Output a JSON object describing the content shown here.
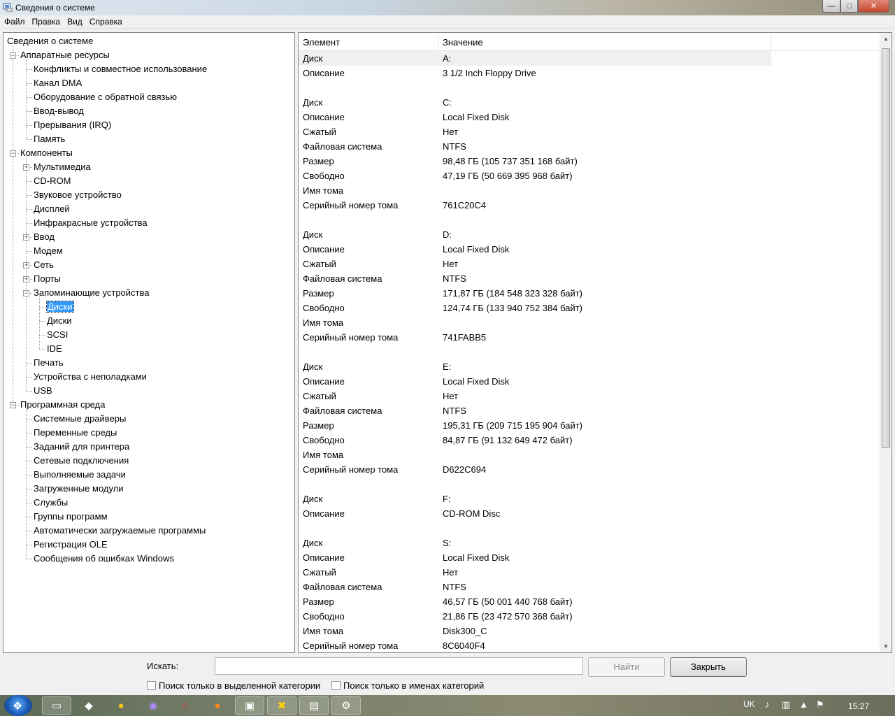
{
  "window": {
    "title": "Сведения о системе",
    "controls": {
      "minimize": "—",
      "maximize": "□",
      "close": "✕"
    }
  },
  "menu": [
    "Файл",
    "Правка",
    "Вид",
    "Справка"
  ],
  "tree": [
    {
      "label": "Сведения о системе",
      "level": 0,
      "expander": ""
    },
    {
      "label": "Аппаратные ресурсы",
      "level": 1,
      "expander": "minus"
    },
    {
      "label": "Конфликты и совместное использование",
      "level": 2,
      "expander": ""
    },
    {
      "label": "Канал DMA",
      "level": 2,
      "expander": ""
    },
    {
      "label": "Оборудование с обратной связью",
      "level": 2,
      "expander": ""
    },
    {
      "label": "Ввод-вывод",
      "level": 2,
      "expander": ""
    },
    {
      "label": "Прерывания (IRQ)",
      "level": 2,
      "expander": ""
    },
    {
      "label": "Память",
      "level": 2,
      "expander": ""
    },
    {
      "label": "Компоненты",
      "level": 1,
      "expander": "minus"
    },
    {
      "label": "Мультимедиа",
      "level": 2,
      "expander": "plus"
    },
    {
      "label": "CD-ROM",
      "level": 2,
      "expander": ""
    },
    {
      "label": "Звуковое устройство",
      "level": 2,
      "expander": ""
    },
    {
      "label": "Дисплей",
      "level": 2,
      "expander": ""
    },
    {
      "label": "Инфракрасные устройства",
      "level": 2,
      "expander": ""
    },
    {
      "label": "Ввод",
      "level": 2,
      "expander": "plus"
    },
    {
      "label": "Модем",
      "level": 2,
      "expander": ""
    },
    {
      "label": "Сеть",
      "level": 2,
      "expander": "plus"
    },
    {
      "label": "Порты",
      "level": 2,
      "expander": "plus"
    },
    {
      "label": "Запоминающие устройства",
      "level": 2,
      "expander": "minus"
    },
    {
      "label": "Диски",
      "level": 3,
      "expander": "",
      "selected": true
    },
    {
      "label": "Диски",
      "level": 3,
      "expander": ""
    },
    {
      "label": "SCSI",
      "level": 3,
      "expander": ""
    },
    {
      "label": "IDE",
      "level": 3,
      "expander": ""
    },
    {
      "label": "Печать",
      "level": 2,
      "expander": ""
    },
    {
      "label": "Устройства с неполадками",
      "level": 2,
      "expander": ""
    },
    {
      "label": "USB",
      "level": 2,
      "expander": ""
    },
    {
      "label": "Программная среда",
      "level": 1,
      "expander": "minus"
    },
    {
      "label": "Системные драйверы",
      "level": 2,
      "expander": ""
    },
    {
      "label": "Переменные среды",
      "level": 2,
      "expander": ""
    },
    {
      "label": "Заданий для принтера",
      "level": 2,
      "expander": ""
    },
    {
      "label": "Сетевые подключения",
      "level": 2,
      "expander": ""
    },
    {
      "label": "Выполняемые задачи",
      "level": 2,
      "expander": ""
    },
    {
      "label": "Загруженные модули",
      "level": 2,
      "expander": ""
    },
    {
      "label": "Службы",
      "level": 2,
      "expander": ""
    },
    {
      "label": "Группы программ",
      "level": 2,
      "expander": ""
    },
    {
      "label": "Автоматически загружаемые программы",
      "level": 2,
      "expander": ""
    },
    {
      "label": "Регистрация OLE",
      "level": 2,
      "expander": ""
    },
    {
      "label": "Сообщения об ошибках Windows",
      "level": 2,
      "expander": ""
    }
  ],
  "details": {
    "columns": [
      "Элемент",
      "Значение",
      ""
    ],
    "rows": [
      [
        "Диск",
        "A:"
      ],
      [
        "Описание",
        "3 1/2 Inch Floppy Drive"
      ],
      [
        "",
        ""
      ],
      [
        "Диск",
        "C:"
      ],
      [
        "Описание",
        "Local Fixed Disk"
      ],
      [
        "Сжатый",
        "Нет"
      ],
      [
        "Файловая система",
        "NTFS"
      ],
      [
        "Размер",
        "98,48 ГБ (105 737 351 168 байт)"
      ],
      [
        "Свободно",
        "47,19 ГБ (50 669 395 968 байт)"
      ],
      [
        "Имя тома",
        ""
      ],
      [
        "Серийный номер тома",
        "761C20C4"
      ],
      [
        "",
        ""
      ],
      [
        "Диск",
        "D:"
      ],
      [
        "Описание",
        "Local Fixed Disk"
      ],
      [
        "Сжатый",
        "Нет"
      ],
      [
        "Файловая система",
        "NTFS"
      ],
      [
        "Размер",
        "171,87 ГБ (184 548 323 328 байт)"
      ],
      [
        "Свободно",
        "124,74 ГБ (133 940 752 384 байт)"
      ],
      [
        "Имя тома",
        ""
      ],
      [
        "Серийный номер тома",
        "741FABB5"
      ],
      [
        "",
        ""
      ],
      [
        "Диск",
        "E:"
      ],
      [
        "Описание",
        "Local Fixed Disk"
      ],
      [
        "Сжатый",
        "Нет"
      ],
      [
        "Файловая система",
        "NTFS"
      ],
      [
        "Размер",
        "195,31 ГБ (209 715 195 904 байт)"
      ],
      [
        "Свободно",
        "84,87 ГБ (91 132 649 472 байт)"
      ],
      [
        "Имя тома",
        ""
      ],
      [
        "Серийный номер тома",
        "D622C694"
      ],
      [
        "",
        ""
      ],
      [
        "Диск",
        "F:"
      ],
      [
        "Описание",
        "CD-ROM Disc"
      ],
      [
        "",
        ""
      ],
      [
        "Диск",
        "S:"
      ],
      [
        "Описание",
        "Local Fixed Disk"
      ],
      [
        "Сжатый",
        "Нет"
      ],
      [
        "Файловая система",
        "NTFS"
      ],
      [
        "Размер",
        "46,57 ГБ (50 001 440 768 байт)"
      ],
      [
        "Свободно",
        "21,86 ГБ (23 472 570 368 байт)"
      ],
      [
        "Имя тома",
        "Disk300_C"
      ],
      [
        "Серийный номер тома",
        "8C6040F4"
      ]
    ]
  },
  "search": {
    "label": "Искать:",
    "value": "",
    "find_button": "Найти",
    "close_button": "Закрыть",
    "option1": "Поиск только в выделенной категории",
    "option2": "Поиск только в именах категорий"
  },
  "taskbar": {
    "language": "UK",
    "time": "15:27",
    "items": [
      "folder-icon",
      "app-icon",
      "chrome-icon",
      "viber-icon",
      "opera-icon",
      "firefox-icon",
      "sysinfo-icon",
      "xnview-icon",
      "monitor-icon",
      "tool-icon"
    ]
  }
}
